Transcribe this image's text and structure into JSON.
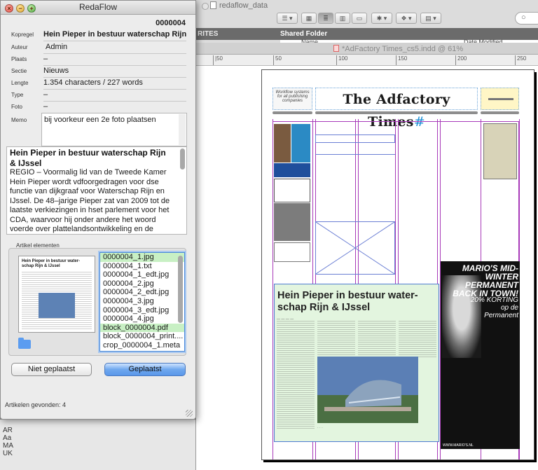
{
  "finder": {
    "title": "redaflow_data",
    "sidebar_header": "RITES",
    "folder_header": "Shared Folder",
    "col_name": "Name",
    "col_date": "Date Modified",
    "search_icon": "magnifier-icon"
  },
  "indesign": {
    "tab_title": "*AdFactory Times_cs5.indd @ 61%",
    "ruler_ticks": [
      "50",
      "100",
      "150",
      "200",
      "250"
    ],
    "masthead": "The Adfactory Times",
    "masthead_mark": "#",
    "adbox_text": "Workflow systems for all publishing companies",
    "article_headline": "Hein Pieper in bestuur water-schap Rijn & IJssel",
    "ad_headline": "MARIO'S MID-WINTER PERMANENT BACK IN TOWN!",
    "ad_offer": "20% KORTING op de Permanent",
    "ad_footer": "WWW.MARIO'S.NL"
  },
  "redaflow": {
    "title": "RedaFlow",
    "article_id": "0000004",
    "fields": [
      {
        "label": "Kopregel",
        "value": "Hein Pieper in bestuur waterschap Rijn  IJ:"
      },
      {
        "label": "Auteur",
        "value": "Admin"
      },
      {
        "label": "Plaats",
        "value": "–"
      },
      {
        "label": "Sectie",
        "value": "Nieuws"
      },
      {
        "label": "Lengte",
        "value": "1.354 characters / 227 words"
      },
      {
        "label": "Type",
        "value": "–"
      },
      {
        "label": "Foto",
        "value": "–"
      }
    ],
    "memo_label": "Memo",
    "memo": "bij voorkeur een 2e foto plaatsen",
    "article_title": "Hein Pieper in bestuur waterschap Rijn & IJssel",
    "article_body": "REGIO – Voormalig lid van de Tweede Kamer Hein Pieper wordt vdfoorgedragen voor dse functie van dijkgraaf voor Waterschap Rijn en IJssel. De 48–jarige Pieper zat van 2009 tot de laatste verkiezingen in hset parlement voor het CDA, waarvoor hij onder andere het woord voerde over plattelandsontwikkeling en de Ecologische Hoofdstructuur.",
    "elements_label": "Artikel elementen",
    "thumb_title": "Hein Pieper in bestuur water-schap Rijn & IJssel",
    "files": [
      "0000004_1.jpg",
      "0000004_1.txt",
      "0000004_1_edt.jpg",
      "0000004_2.jpg",
      "0000004_2_edt.jpg",
      "0000004_3.jpg",
      "0000004_3_edt.jpg",
      "0000004_4.jpg",
      "block_0000004.pdf",
      "block_0000004_print....",
      "crop_0000004_1.meta"
    ],
    "btn_not_placed": "Niet geplaatst",
    "btn_placed": "Geplaatst",
    "found": "Artikelen gevonden: 4"
  },
  "peek": {
    "rows": [
      "AR",
      "Aa",
      "MA",
      "UK"
    ]
  }
}
